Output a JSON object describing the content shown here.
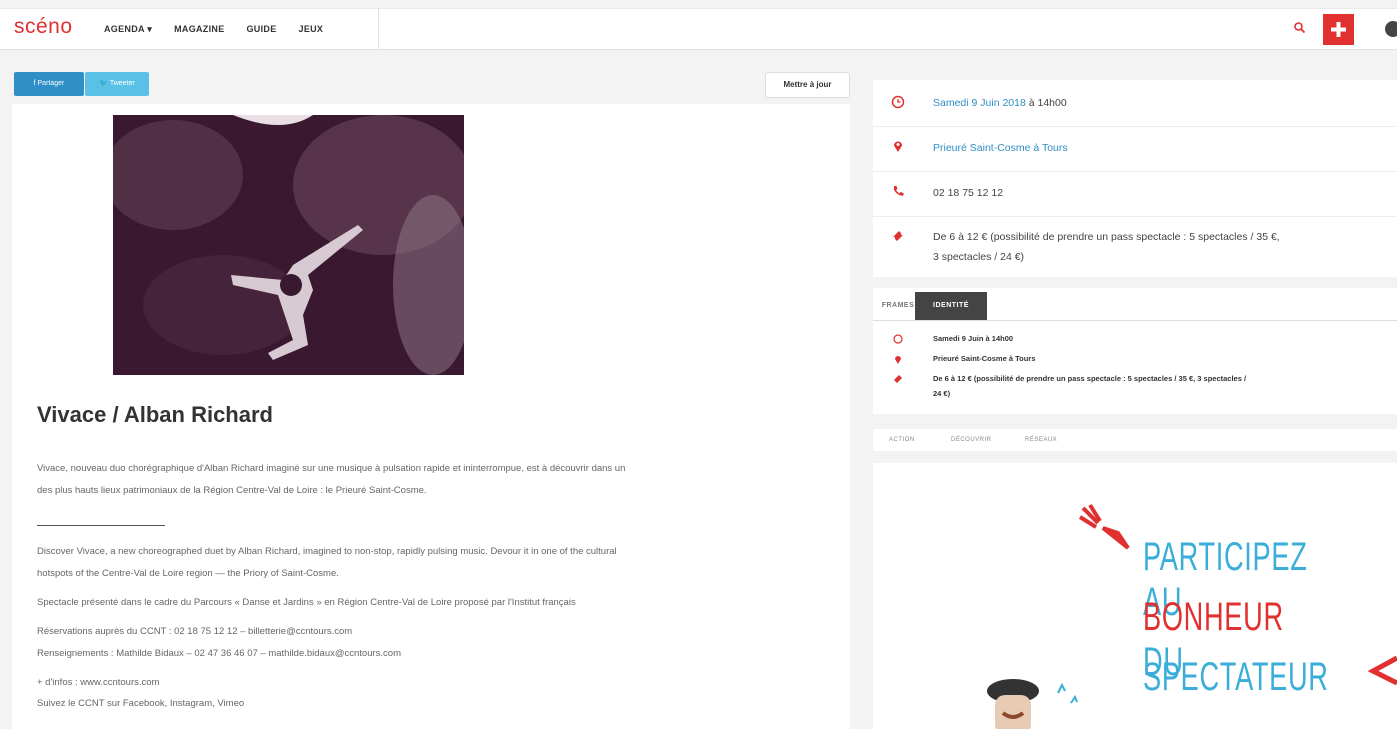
{
  "header": {
    "logo": "scéno",
    "nav": [
      "AGENDA ▾",
      "MAGAZINE",
      "GUIDE",
      "JEUX"
    ]
  },
  "share": {
    "facebook": "f Partager",
    "twitter": "🐦 Tweeter"
  },
  "update_button": "Mettre à jour",
  "article": {
    "title": "Vivace / Alban Richard",
    "paragraphs": [
      "Vivace, nouveau duo chorégraphique d'Alban Richard imaginé sur une musique à pulsation rapide et ininterrompue, est à découvrir dans un",
      "des plus hauts lieux patrimoniaux de la Région Centre-Val de Loire : le Prieuré Saint-Cosme.",
      "Discover Vivace, a new choreographed duet by Alban Richard, imagined to non-stop, rapidly pulsing music. Devour it in one of the cultural",
      "hotspots of the Centre-Val de Loire region — the Priory of Saint-Cosme.",
      "Spectacle présenté dans le cadre du Parcours « Danse et Jardins » en Région Centre-Val de Loire proposé par l'Institut français",
      "Réservations auprès du CCNT : 02 18 75 12 12 – billetterie@ccntours.com",
      "Renseignements : Mathilde Bidaux – 02 47 36 46 07 – mathilde.bidaux@ccntours.com",
      "+ d'infos : www.ccntours.com",
      "Suivez le CCNT sur Facebook, Instagram, Vimeo"
    ]
  },
  "info": {
    "date": "Samedi 9 Juin 2018",
    "date_suffix": " à 14h00",
    "place": "Prieuré Saint-Cosme à Tours",
    "phone": "02 18 75 12 12",
    "price_line1": "De 6 à 12 € (possibilité de prendre un pass spectacle : 5 spectacles / 35 €,",
    "price_line2": "3 spectacles / 24 €)"
  },
  "tabs": {
    "frames": "FRAMES",
    "active": "IDENTITÉ",
    "date": "Samedi 9 Juin à 14h00",
    "place": "Prieuré Saint-Cosme à Tours",
    "price_line1": "De 6 à 12 € (possibilité de prendre un pass spectacle : 5 spectacles / 35 €, 3 spectacles /",
    "price_line2": "24 €)"
  },
  "subtabs": [
    "ACTION",
    "DÉCOUVRIR",
    "RÉSEAUX"
  ],
  "ad": {
    "line1": "PARTICIPEZ AU",
    "line2_a": "BONHEUR",
    "line2_b": " DU",
    "line3": "SPECTATEUR"
  },
  "colors": {
    "accent": "#e0302f",
    "link": "#2f8fc7",
    "ad_blue": "#3aaed8"
  }
}
